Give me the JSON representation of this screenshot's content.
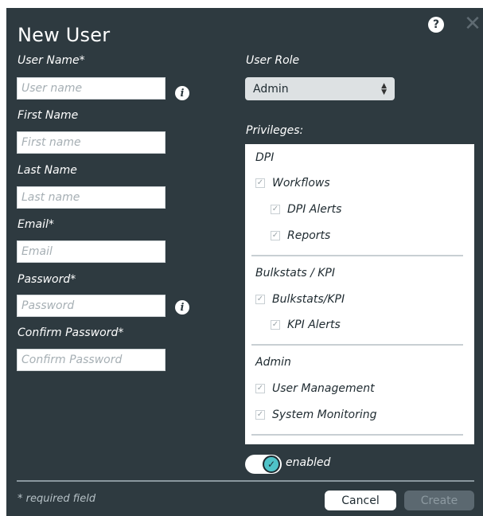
{
  "dialog": {
    "title": "New User",
    "help_icon_glyph": "?",
    "close_icon_glyph": "✕"
  },
  "fields": {
    "user_name": {
      "label": "User Name*",
      "placeholder": "User name"
    },
    "first_name": {
      "label": "First Name",
      "placeholder": "First name"
    },
    "last_name": {
      "label": "Last Name",
      "placeholder": "Last name"
    },
    "email": {
      "label": "Email*",
      "placeholder": "Email"
    },
    "password": {
      "label": "Password*",
      "placeholder": "Password"
    },
    "confirm_password": {
      "label": "Confirm Password*",
      "placeholder": "Confirm Password"
    }
  },
  "info_icon_glyph": "i",
  "role": {
    "label": "User Role",
    "selected": "Admin",
    "arrow_up": "▲",
    "arrow_down": "▼"
  },
  "privileges": {
    "label": "Privileges:",
    "check_glyph": "✓",
    "groups": [
      {
        "title": "DPI",
        "items": [
          "Workflows",
          "DPI Alerts",
          "Reports"
        ]
      },
      {
        "title": "Bulkstats / KPI",
        "items": [
          "Bulkstats/KPI",
          "KPI Alerts"
        ]
      },
      {
        "title": "Admin",
        "items": [
          "User Management",
          "System Monitoring"
        ]
      }
    ]
  },
  "toggle": {
    "label": "enabled",
    "state": "on",
    "glyph": "✓"
  },
  "footer": {
    "required_note": "* required field",
    "cancel_label": "Cancel",
    "create_label": "Create"
  },
  "colors": {
    "dialog_bg": "#2e3a40",
    "accent": "#4fc3c8",
    "disabled_button": "#5b6870"
  }
}
